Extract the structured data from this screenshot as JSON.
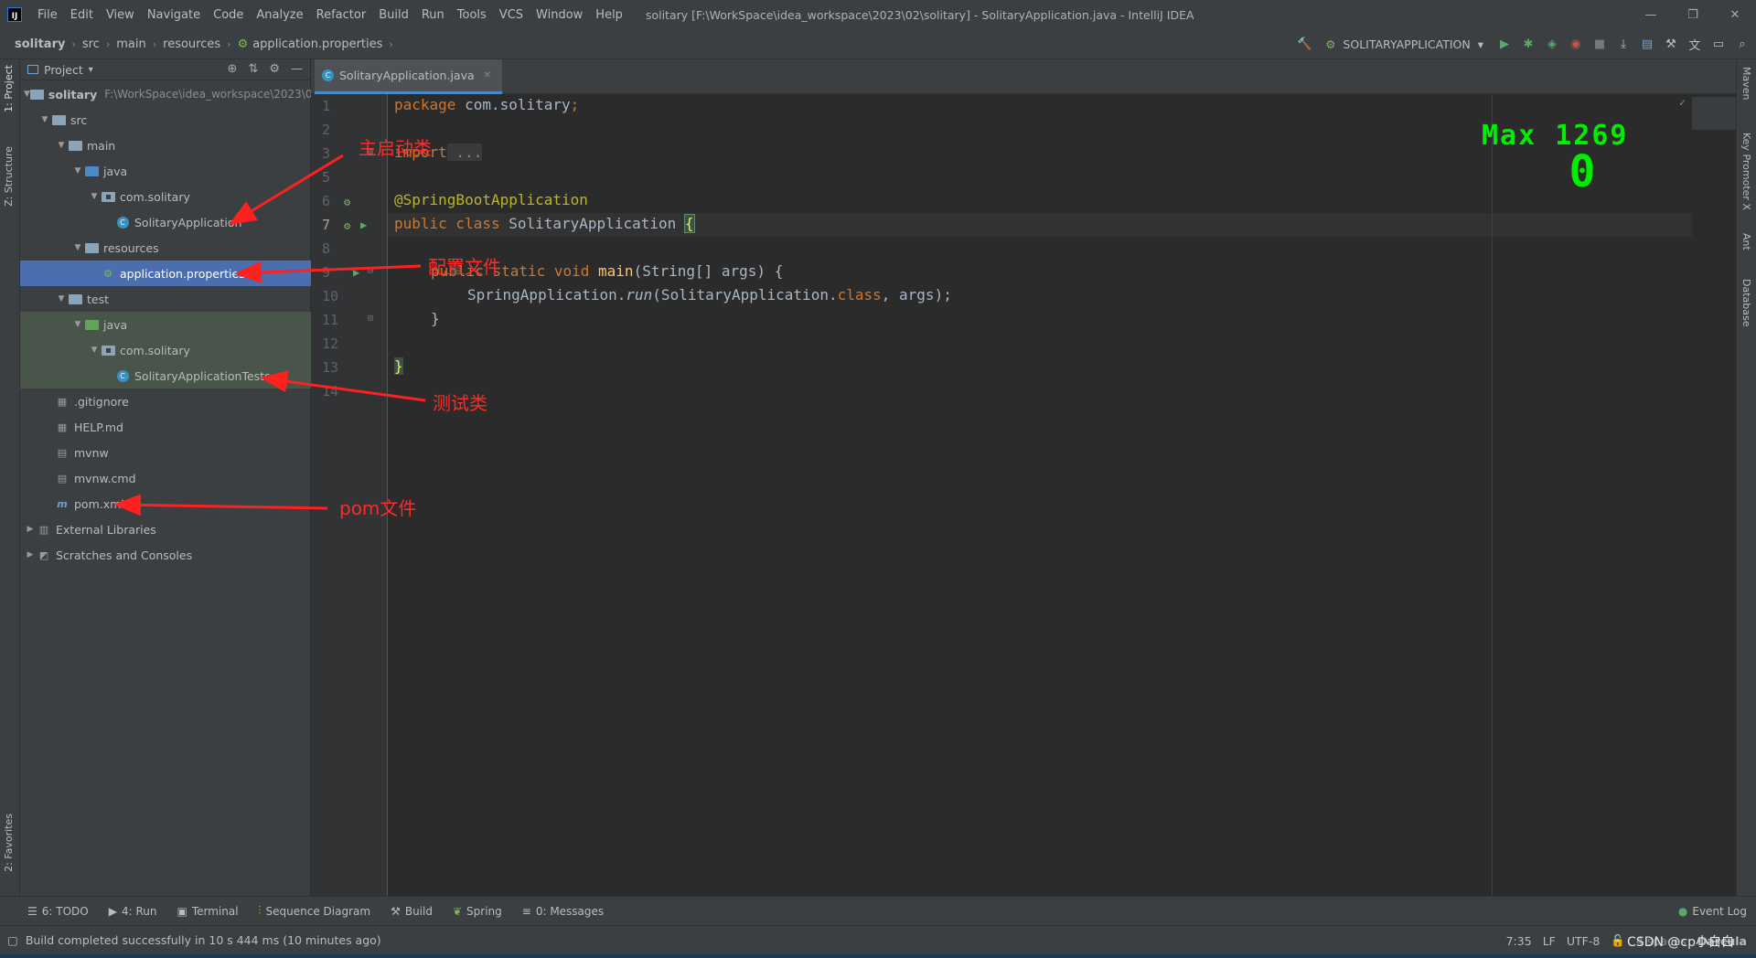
{
  "menu": [
    "File",
    "Edit",
    "View",
    "Navigate",
    "Code",
    "Analyze",
    "Refactor",
    "Build",
    "Run",
    "Tools",
    "VCS",
    "Window",
    "Help"
  ],
  "window_title": "solitary [F:\\WorkSpace\\idea_workspace\\2023\\02\\solitary] - SolitaryApplication.java - IntelliJ IDEA",
  "breadcrumb": [
    "solitary",
    "src",
    "main",
    "resources",
    "application.properties"
  ],
  "run_config": "SOLITARYAPPLICATION",
  "project_panel": {
    "title": "Project",
    "root_path": "F:\\WorkSpace\\idea_workspace\\2023\\0...",
    "tree": [
      {
        "label": "solitary"
      },
      {
        "label": "src"
      },
      {
        "label": "main"
      },
      {
        "label": "java"
      },
      {
        "label": "com.solitary"
      },
      {
        "label": "SolitaryApplication"
      },
      {
        "label": "resources"
      },
      {
        "label": "application.properties"
      },
      {
        "label": "test"
      },
      {
        "label": "java"
      },
      {
        "label": "com.solitary"
      },
      {
        "label": "SolitaryApplicationTests"
      },
      {
        "label": ".gitignore"
      },
      {
        "label": "HELP.md"
      },
      {
        "label": "mvnw"
      },
      {
        "label": "mvnw.cmd"
      },
      {
        "label": "pom.xml"
      },
      {
        "label": "External Libraries"
      },
      {
        "label": "Scratches and Consoles"
      }
    ]
  },
  "left_tool_tabs": [
    "1: Project",
    "Z: Structure",
    "2: Favorites"
  ],
  "right_tool_tabs": [
    "Maven",
    "Key Promoter X",
    "Ant",
    "Database"
  ],
  "editor_tab": "SolitaryApplication.java",
  "line_numbers": [
    "1",
    "2",
    "3",
    "5",
    "6",
    "7",
    "8",
    "9",
    "10",
    "11",
    "12",
    "13",
    "14"
  ],
  "code": {
    "l1_kw": "package",
    "l1_rest": " com.solitary",
    "l1_semi": ";",
    "l3_kw": "import",
    "l3_rest": " ...",
    "l6": "@SpringBootApplication",
    "l7_kw": "public class",
    "l7_rest": " SolitaryApplication ",
    "l7_brace": "{",
    "l9_kw": "public static void",
    "l9_fn": " main",
    "l9_rest": "(String[] args) {",
    "l10_a": "SpringApplication.",
    "l10_run": "run",
    "l10_b": "(SolitaryApplication.",
    "l10_kw": "class",
    "l10_c": ", args);",
    "l11": "}",
    "l13": "}"
  },
  "score": {
    "title": "Max 1269",
    "value": "0"
  },
  "annotations": {
    "main_class": "主启动类",
    "config": "配置文件",
    "test": "测试类",
    "pom": "pom文件"
  },
  "bottom_tabs": [
    "6: TODO",
    "4: Run",
    "Terminal",
    "Sequence Diagram",
    "Build",
    "Spring",
    "0: Messages"
  ],
  "event_log": "Event Log",
  "status": {
    "message": "Build completed successfully in 10 s 444 ms (10 minutes ago)",
    "position": "7:35",
    "line_sep": "LF",
    "encoding": "UTF-8",
    "indent": "4 spaces",
    "theme": "Darcula"
  },
  "watermark": "CSDN @cp小白白"
}
